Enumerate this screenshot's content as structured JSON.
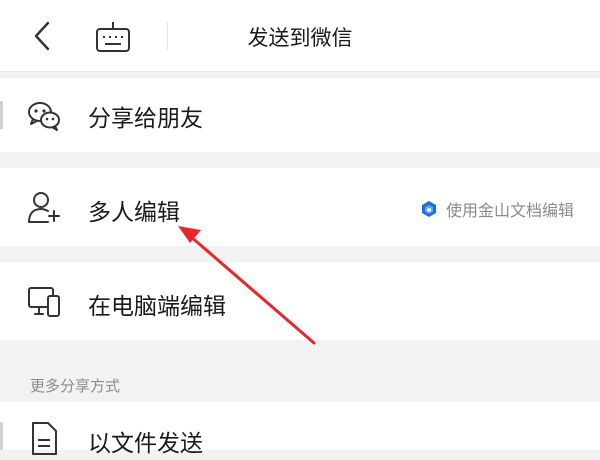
{
  "header": {
    "title": "发送到微信"
  },
  "rows": [
    {
      "label": "分享给朋友",
      "icon": "wechat-icon"
    },
    {
      "label": "多人编辑",
      "icon": "add-user-icon",
      "hint": "使用金山文档编辑",
      "hint_icon": "kdocs-logo-icon"
    },
    {
      "label": "在电脑端编辑",
      "icon": "devices-icon"
    },
    {
      "label": "以文件发送",
      "icon": "document-icon"
    }
  ],
  "section": {
    "more_share_title": "更多分享方式"
  },
  "colors": {
    "annotation_arrow": "#e8262b",
    "brand_blue": "#1f6fd8"
  }
}
